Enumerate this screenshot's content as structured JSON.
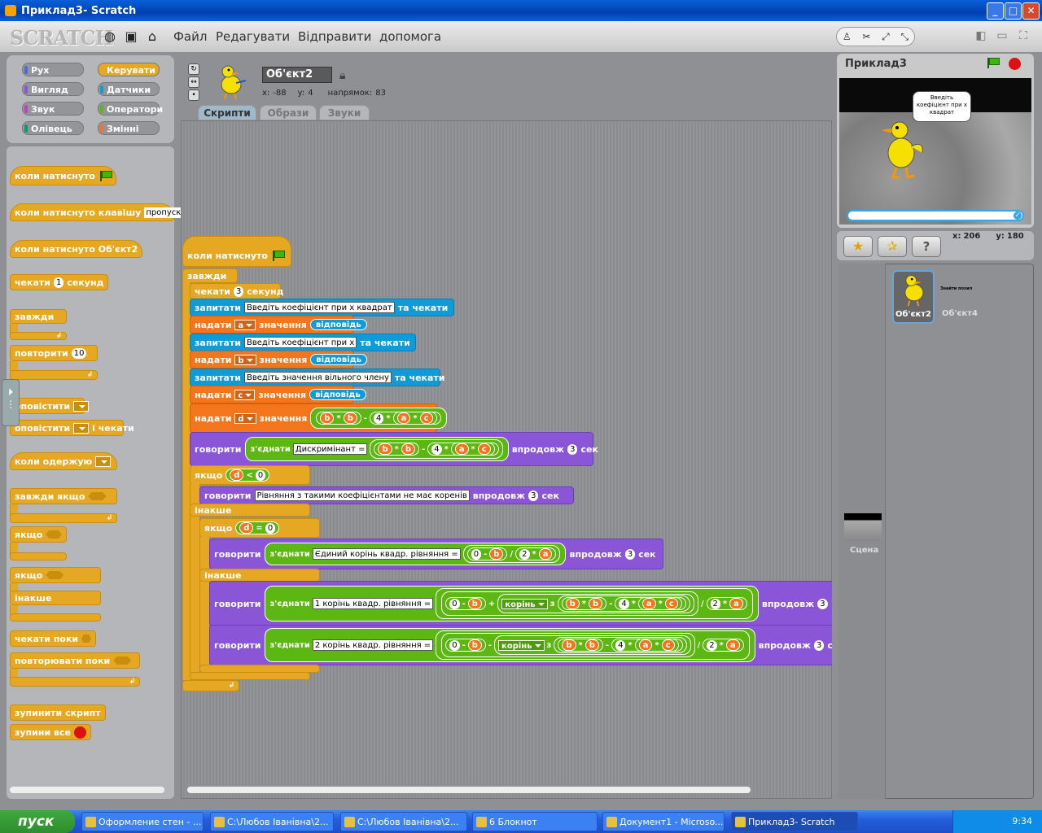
{
  "window": {
    "title": "Приклад3- Scratch"
  },
  "menu": {
    "logo": "SCRATCH",
    "items": [
      "Файл",
      "Редагувати",
      "Відправити",
      "допомога"
    ]
  },
  "categories": [
    {
      "label": "Рух",
      "color": "#4a6cd4"
    },
    {
      "label": "Керувати",
      "color": "#e6a822"
    },
    {
      "label": "Вигляд",
      "color": "#8a55d7"
    },
    {
      "label": "Датчики",
      "color": "#0e9bd8"
    },
    {
      "label": "Звук",
      "color": "#bb42c3"
    },
    {
      "label": "Оператори",
      "color": "#5cb712"
    },
    {
      "label": "Олівець",
      "color": "#0e9a6c"
    },
    {
      "label": "Змінні",
      "color": "#f3761d"
    }
  ],
  "palette": {
    "when_flag": "коли натиснуто",
    "when_key": "коли натиснуто клавішу",
    "key_value": "пропуск",
    "when_sprite": "коли натиснуто Об'єкт2",
    "wait": "чекати",
    "wait_num": "1",
    "wait_unit": "секунд",
    "forever": "завжди",
    "repeat": "повторити",
    "repeat_num": "10",
    "broadcast": "оповістити",
    "broadcast_wait": "оповістити",
    "broadcast_wait_suffix": "і чекати",
    "when_receive": "коли одержую",
    "forever_if": "завжди якщо",
    "if": "якщо",
    "if2": "якщо",
    "else": "інакше",
    "wait_until": "чекати поки",
    "repeat_until": "повторювати поки",
    "stop_script": "зупинити скрипт",
    "stop_all": "зупини все"
  },
  "sprite": {
    "name": "Об'єкт2",
    "x_label": "x:",
    "x": "-88",
    "y_label": "y:",
    "y": "4",
    "dir_label": "напрямок:",
    "dir": "83"
  },
  "tabs": [
    "Скрипти",
    "Образи",
    "Звуки"
  ],
  "script": {
    "hat": "коли натиснуто",
    "forever": "завжди",
    "wait": "чекати",
    "wait_num": "3",
    "wait_unit": "секунд",
    "ask": "запитати",
    "and_wait": "та чекати",
    "q1": "Введіть  коефіцієнт  при х квадрат",
    "q2": "Введіть  коефіцієнт  при х",
    "q3": "Введіть значення вільного члену",
    "set": "надати",
    "to_value": "значення",
    "answer": "відповідь",
    "var_a": "a",
    "var_b": "b",
    "var_c": "c",
    "var_d": "d",
    "say": "говорити",
    "join": "з'єднати",
    "for": "впродовж",
    "sec": "сек",
    "say_secs": "3",
    "disc_label": "Дискримінант =",
    "num4": "4",
    "num0": "0",
    "num2": "2",
    "op_mul": "*",
    "op_minus": "-",
    "op_plus": "+",
    "op_div": "/",
    "op_lt": "<",
    "op_eq": "=",
    "if": "якщо",
    "else": "інакше",
    "no_roots": "Рівняння  з такими коефіцієнтами не має коренів",
    "one_root": "Єдиний корінь квадр. рівняння =",
    "root1": "1 корінь квадр. рівняння =",
    "root2": "2 корінь квадр. рівняння =",
    "sqrt": "корінь",
    "of": "з",
    "cut_c": "с"
  },
  "stage": {
    "title": "Приклад3",
    "bubble": "Введіть коефіцієнт при х квадрат",
    "coords_x_label": "x:",
    "coords_x": "206",
    "coords_y_label": "y:",
    "coords_y": "180"
  },
  "sprites_list": {
    "selected": "Об'єкт2",
    "other": "Об'єкт4",
    "tiny_label": "Знайти похил",
    "stage_label": "Сцена"
  },
  "taskbar": {
    "start": "пуск",
    "items": [
      "Оформление стен - ...",
      "C:\\Любов Іванівна\\2...",
      "C:\\Любов Іванівна\\2...",
      "6 Блокнот",
      "Документ1 - Microso...",
      "Приклад3- Scratch"
    ],
    "clock": "9:34"
  }
}
